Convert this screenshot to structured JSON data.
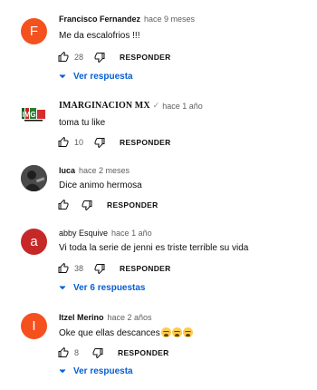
{
  "comments": [
    {
      "author": "Francisco Fernandez",
      "time": "hace 9 meses",
      "text": "Me da escalofrios !!!",
      "likes": "28",
      "reply_label": "RESPONDER",
      "replies_label": "Ver respuesta",
      "avatar_letter": "F",
      "avatar_color": "#f4511e"
    },
    {
      "author": "IMARGINACION MX",
      "verified_mark": "✓",
      "time": "hace 1 año",
      "text": "toma tu like",
      "likes": "10",
      "reply_label": "RESPONDER",
      "avatar_logo_text": "IMG"
    },
    {
      "author": "luca",
      "time": "hace 2 meses",
      "text": "Dice animo hermosa",
      "likes": "",
      "reply_label": "RESPONDER"
    },
    {
      "author": "abby Esquive",
      "time": "hace 1 año",
      "text": "Vi toda la serie de jenni es triste terrible su vida",
      "likes": "38",
      "reply_label": "RESPONDER",
      "replies_label": "Ver 6 respuestas",
      "avatar_letter": "a",
      "avatar_color": "#c62828"
    },
    {
      "author": "Itzel Merino",
      "time": "hace 2 años",
      "text": "Oke que ellas descances",
      "likes": "8",
      "reply_label": "RESPONDER",
      "replies_label": "Ver respuesta",
      "avatar_letter": "I",
      "avatar_color": "#f4511e"
    }
  ],
  "colors": {
    "link_blue": "#065fd4",
    "secondary_text": "#606060"
  },
  "icons": {
    "like": "thumbs-up-icon",
    "dislike": "thumbs-down-icon",
    "expand": "chevron-down-icon",
    "emoji": "crying-face-emoji"
  }
}
